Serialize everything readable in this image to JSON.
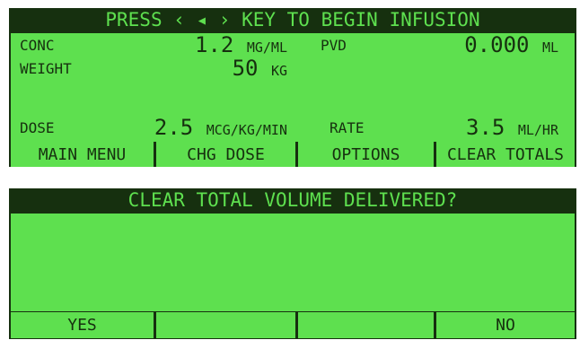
{
  "infusion_screen": {
    "banner": "PRESS ‹ ◂ › KEY TO BEGIN INFUSION",
    "conc": {
      "label": "CONC",
      "value": "1.2",
      "unit": "MG/ML"
    },
    "pvd": {
      "label": "PVD",
      "value": "0.000",
      "unit": "ML"
    },
    "weight": {
      "label": "WEIGHT",
      "value": "50",
      "unit": "KG"
    },
    "dose": {
      "label": "DOSE",
      "value": "2.5",
      "unit": "MCG/KG/MIN"
    },
    "rate": {
      "label": "RATE",
      "value": "3.5",
      "unit": "ML/HR"
    },
    "softkeys": [
      "MAIN MENU",
      "CHG DOSE",
      "OPTIONS",
      "CLEAR TOTALS"
    ]
  },
  "confirm_screen": {
    "banner": "CLEAR TOTAL VOLUME DELIVERED?",
    "softkeys": [
      "YES",
      "",
      "",
      "NO"
    ]
  },
  "colors": {
    "lcd_dark": "#16300f",
    "lcd_green": "#5ee04f",
    "background": "#ffffff"
  }
}
